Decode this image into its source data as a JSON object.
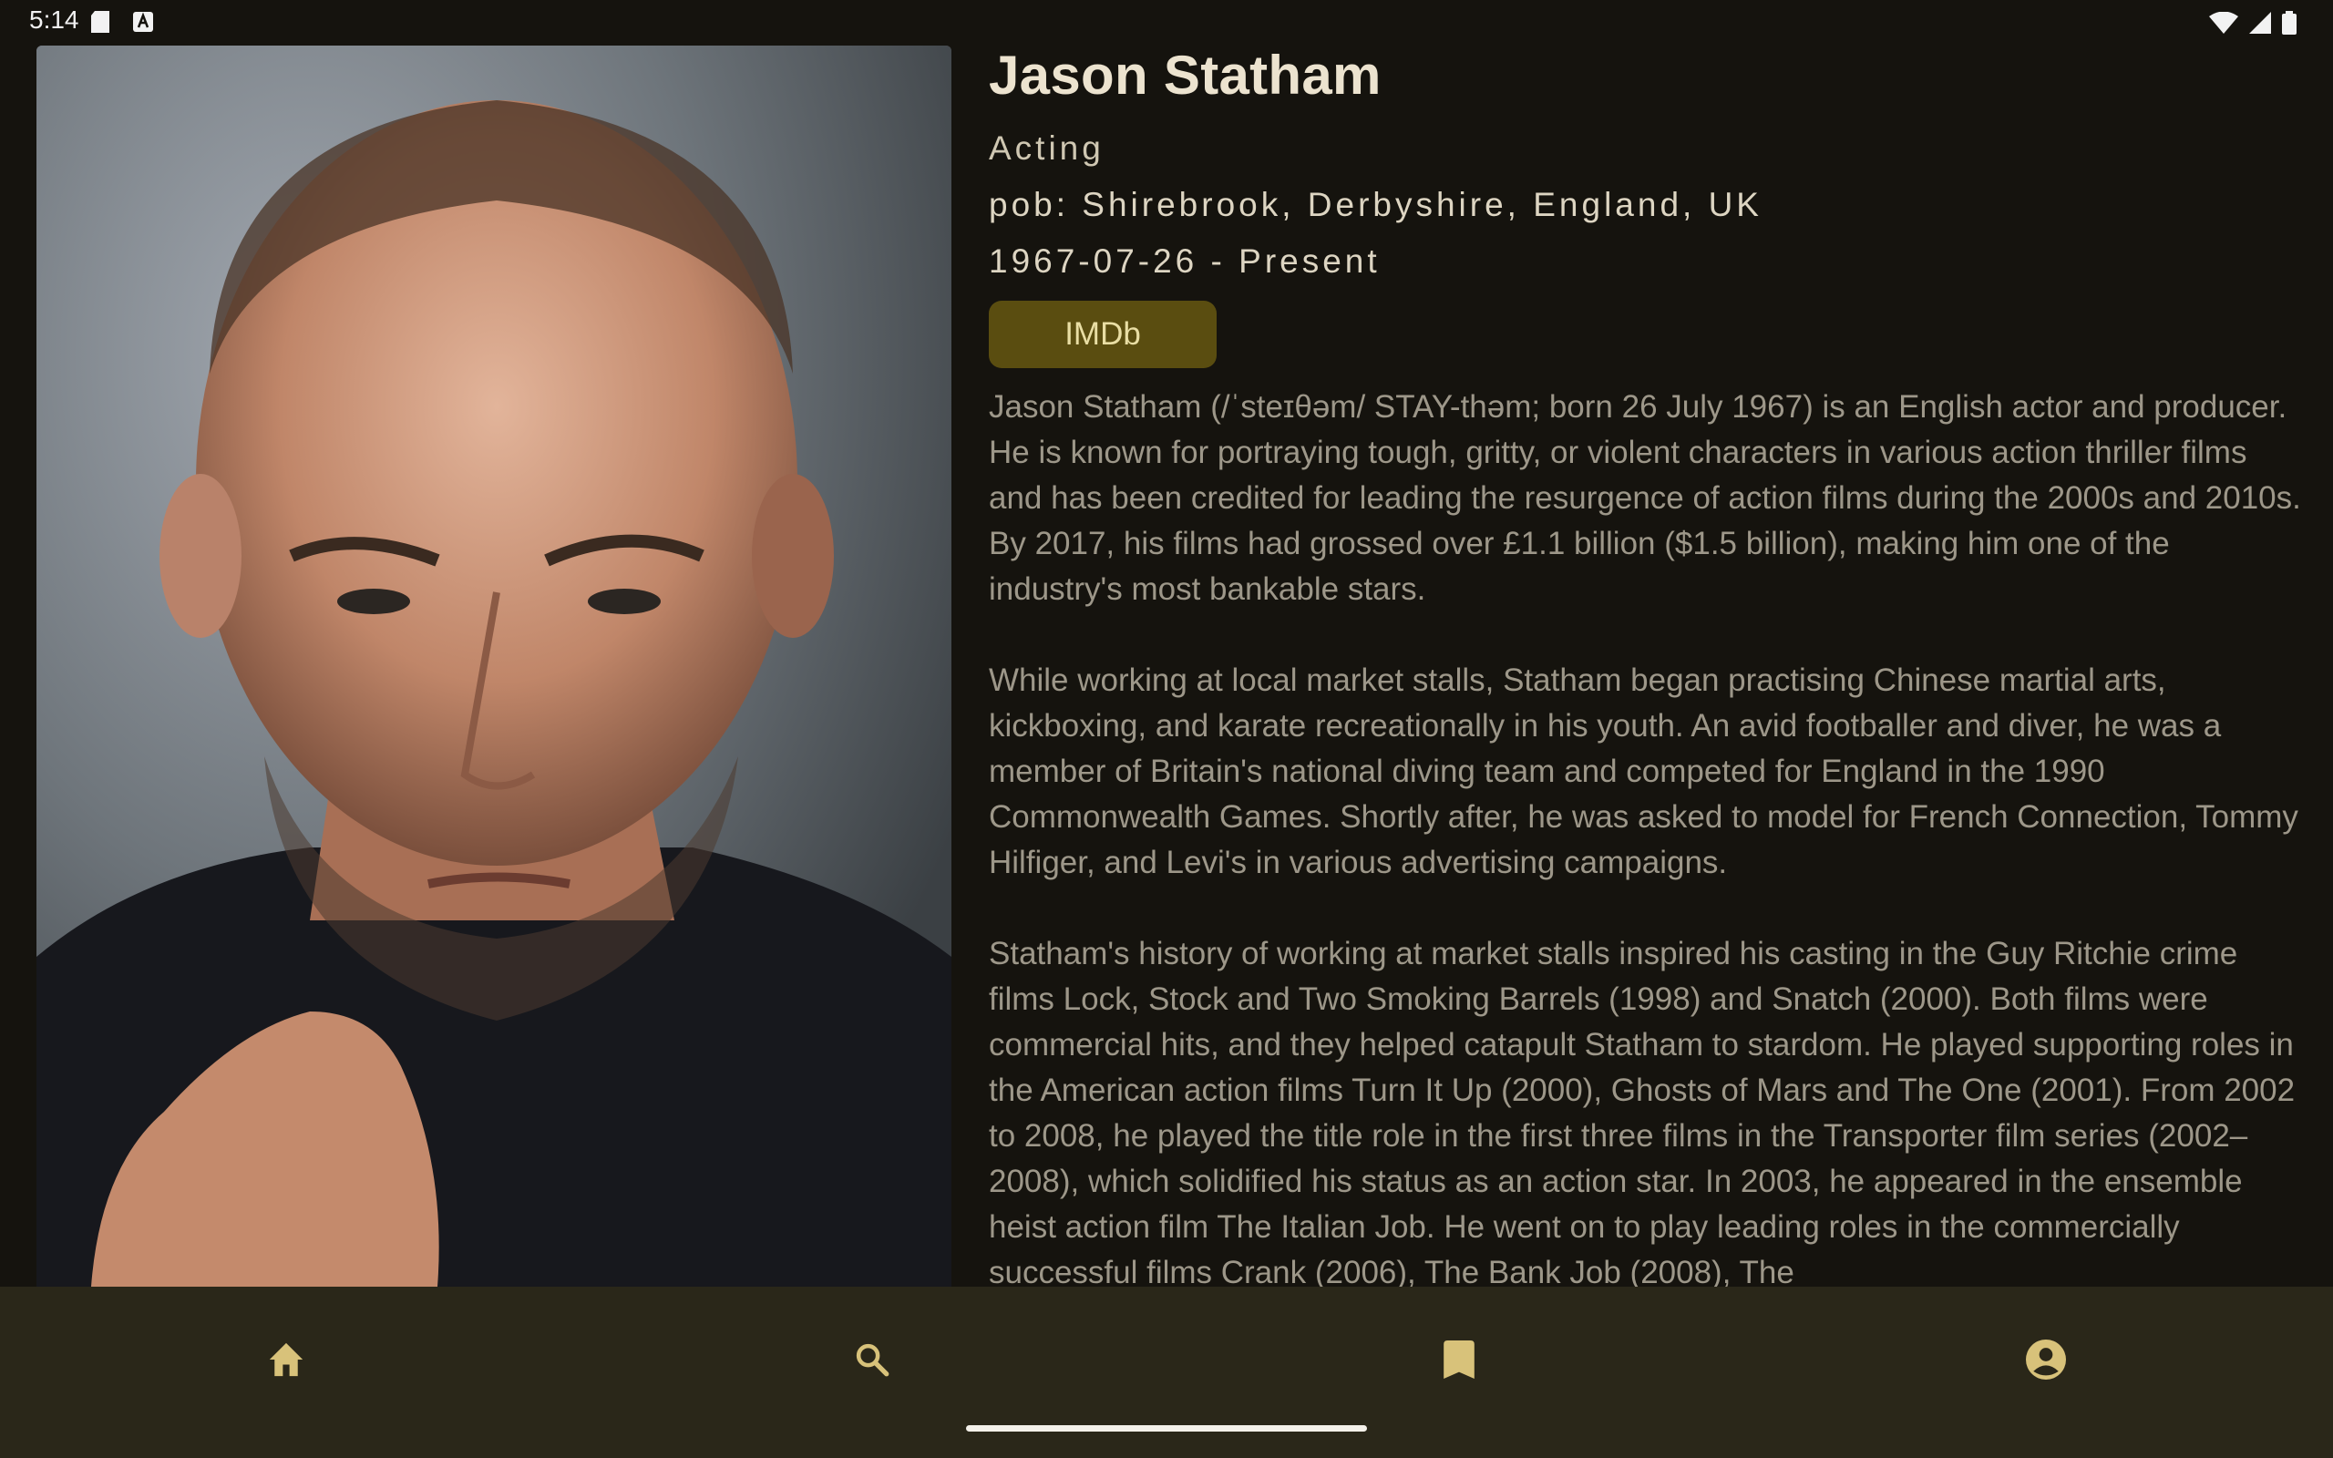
{
  "status_bar": {
    "time": "5:14",
    "left_icons": [
      "sd-card-icon",
      "keyboard-a-icon"
    ],
    "right_icons": [
      "wifi-icon",
      "cell-signal-icon",
      "battery-icon"
    ]
  },
  "person": {
    "name": "Jason Statham",
    "department": "Acting",
    "place_of_birth": "pob: Shirebrook, Derbyshire, England, UK",
    "lifespan": "1967-07-26 - Present",
    "imdb_label": "IMDb",
    "bio": [
      "Jason Statham (/ˈsteɪθəm/ STAY-thəm; born 26 July 1967) is an English actor and producer. He is known for portraying tough, gritty, or violent characters in various action thriller films and has been credited for leading the resurgence of action films during the 2000s and 2010s. By 2017, his films had grossed over £1.1 billion ($1.5 billion), making him one of the industry's most bankable stars.",
      "While working at local market stalls, Statham began practising Chinese martial arts, kickboxing, and karate recreationally in his youth. An avid footballer and diver, he was a member of Britain's national diving team and competed for England in the 1990 Commonwealth Games. Shortly after, he was asked to model for French Connection, Tommy Hilfiger, and Levi's in various advertising campaigns.",
      "Statham's history of working at market stalls inspired his casting in the Guy Ritchie crime films Lock, Stock and Two Smoking Barrels (1998) and Snatch (2000). Both films were commercial hits, and they helped catapult Statham to stardom. He played supporting roles in the American action films Turn It Up (2000), Ghosts of Mars and The One (2001). From 2002 to 2008, he played the title role in the first three films in the Transporter film series (2002–2008), which solidified his status as an action star. In 2003, he appeared in the ensemble heist action film The Italian Job. He went on to play leading roles in the commercially successful films Crank (2006), The Bank Job (2008), The"
    ]
  },
  "bottom_nav": {
    "items": [
      {
        "icon": "home-icon"
      },
      {
        "icon": "search-icon"
      },
      {
        "icon": "bookmark-icon"
      },
      {
        "icon": "account-circle-icon"
      }
    ]
  },
  "colors": {
    "background": "#15130e",
    "accent": "#d8c27a",
    "nav_background": "#2a2719",
    "imdb_button": "#5a4d10"
  }
}
